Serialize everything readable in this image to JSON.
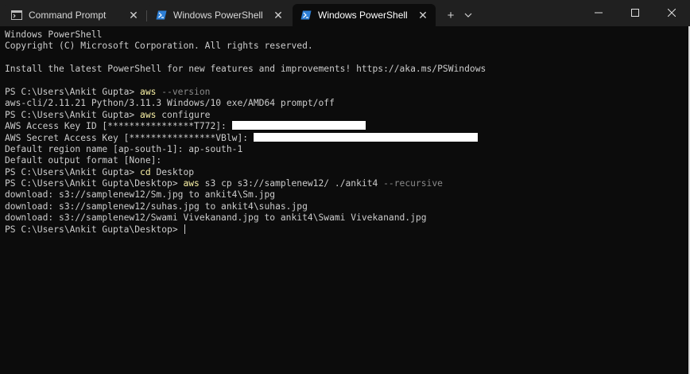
{
  "tabs": [
    {
      "label": "Command Prompt",
      "icon": "cmd-icon",
      "active": false
    },
    {
      "label": "Windows PowerShell",
      "icon": "powershell-icon",
      "active": false
    },
    {
      "label": "Windows PowerShell",
      "icon": "powershell-icon",
      "active": true
    }
  ],
  "tab_actions": {
    "new_tab": "+",
    "dropdown": "⌄"
  },
  "window_controls": {
    "minimize": "—",
    "maximize": "☐",
    "close": "✕"
  },
  "terminal": {
    "banner1": "Windows PowerShell",
    "banner2": "Copyright (C) Microsoft Corporation. All rights reserved.",
    "banner3": "Install the latest PowerShell for new features and improvements! https://aka.ms/PSWindows",
    "prompt_home": "PS C:\\Users\\Ankit Gupta> ",
    "prompt_desktop": "PS C:\\Users\\Ankit Gupta\\Desktop> ",
    "cmd1": "aws",
    "cmd1_flag": " --version",
    "out1": "aws-cli/2.11.21 Python/3.11.3 Windows/10 exe/AMD64 prompt/off",
    "cmd2": "aws",
    "cmd2_arg": " configure",
    "access_key_label": "AWS Access Key ID [****************T772]: ",
    "secret_key_label": "AWS Secret Access Key [****************VBlw]: ",
    "region_line": "Default region name [ap-south-1]: ap-south-1",
    "output_line": "Default output format [None]:",
    "cmd3": "cd",
    "cmd3_arg": " Desktop",
    "cmd4": "aws",
    "cmd4_arg": " s3 cp s3://samplenew12/ ./ankit4",
    "cmd4_flag": " --recursive",
    "dl1": "download: s3://samplenew12/Sm.jpg to ankit4\\Sm.jpg",
    "dl2": "download: s3://samplenew12/suhas.jpg to ankit4\\suhas.jpg",
    "dl3": "download: s3://samplenew12/Swami Vivekanand.jpg to ankit4\\Swami Vivekanand.jpg"
  },
  "colors": {
    "background": "#0c0c0c",
    "text": "#cccccc",
    "command": "#f9f1a5",
    "parameter": "#8a8a8a",
    "titlebar": "#202020"
  }
}
